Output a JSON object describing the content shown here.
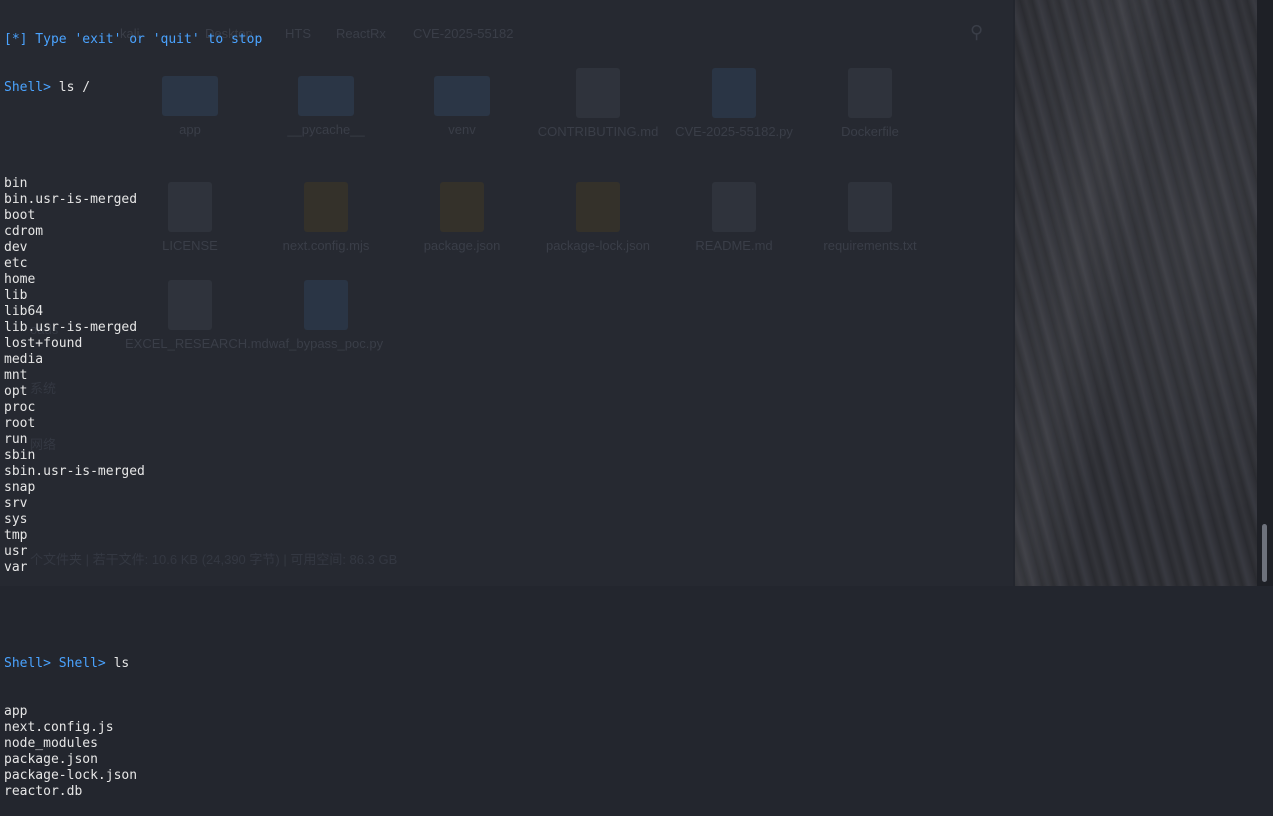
{
  "background": {
    "file_manager": {
      "breadcrumb": [
        "kali",
        "Desktop",
        "HTS",
        "ReactRx",
        "CVE-2025-55182"
      ],
      "files_row1": [
        "app",
        "__pycache__",
        "venv",
        "CONTRIBUTING.md",
        "CVE-2025-55182.py",
        "Dockerfile"
      ],
      "files_row2": [
        "LICENSE",
        "next.config.mjs",
        "package.json",
        "package-lock.json",
        "README.md",
        "requirements.txt"
      ],
      "files_row3": [
        "EXCEL_RESEARCH.md",
        "waf_bypass_poc.py"
      ],
      "sidebar": [
        "oads",
        "系统",
        "网络"
      ],
      "status": "个文件夹 | 若干文件: 10.6 KB (24,390 字节) | 可用空间: 86.3 GB"
    }
  },
  "terminal": {
    "intro": "[*] Type 'exit' or 'quit' to stop",
    "prompt": "Shell>",
    "cmd1": "ls /",
    "root_listing": [
      "bin",
      "bin.usr-is-merged",
      "boot",
      "cdrom",
      "dev",
      "etc",
      "home",
      "lib",
      "lib64",
      "lib.usr-is-merged",
      "lost+found",
      "media",
      "mnt",
      "opt",
      "proc",
      "root",
      "run",
      "sbin",
      "sbin.usr-is-merged",
      "snap",
      "srv",
      "sys",
      "tmp",
      "usr",
      "var"
    ],
    "prompt2": "Shell> Shell>",
    "cmd2": "ls",
    "cwd_listing": [
      "app",
      "next.config.js",
      "node_modules",
      "package.json",
      "package-lock.json",
      "reactor.db"
    ]
  },
  "colors": {
    "prompt": "#4aa3ff",
    "text": "#e6e6e6",
    "background": "#23262e"
  }
}
